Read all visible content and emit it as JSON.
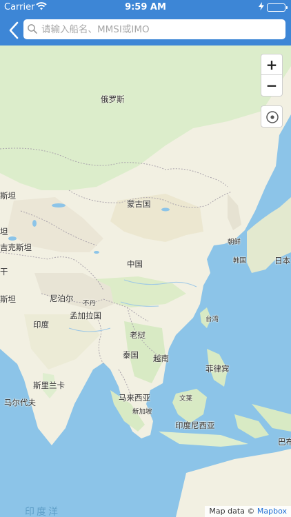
{
  "status_bar": {
    "carrier": "Carrier",
    "time": "9:59 AM",
    "battery_level": 1.0
  },
  "nav": {
    "back_icon": "chevron-left-icon",
    "search_icon": "search-icon",
    "search_placeholder": "请输入船名、MMSI或IMO",
    "search_value": ""
  },
  "map": {
    "labels": {
      "russia": "俄罗斯",
      "kazakhstan": "斯坦",
      "mongolia": "蒙古国",
      "uzbek": "坦",
      "kyrgyz": "吉克斯坦",
      "pak_edge": "干",
      "afghan_edge": "斯坦",
      "china": "中国",
      "north_korea": "朝鲜",
      "south_korea": "韩国",
      "japan": "日本",
      "nepal": "尼泊尔",
      "bhutan": "不丹",
      "bangladesh": "孟加拉国",
      "india": "印度",
      "taiwan": "台湾",
      "laos": "老挝",
      "thailand": "泰国",
      "vietnam": "越南",
      "philippines": "菲律宾",
      "sri_lanka": "斯里兰卡",
      "maldives": "马尔代夫",
      "malaysia": "马来西亚",
      "brunei": "文莱",
      "singapore": "新加坡",
      "indonesia": "印度尼西亚",
      "png_edge": "巴布",
      "indian_ocean": "印度洋"
    },
    "zoom_in_label": "+",
    "zoom_out_label": "−",
    "locate_icon": "locate-icon",
    "attribution_prefix": "Map data ©",
    "attribution_link": "Mapbox"
  },
  "colors": {
    "header_bg": "#3d86d6",
    "land": "#f2f0e2",
    "land_green": "#d9ebc6",
    "water": "#8cc4e8",
    "border": "#a9a2ab"
  }
}
